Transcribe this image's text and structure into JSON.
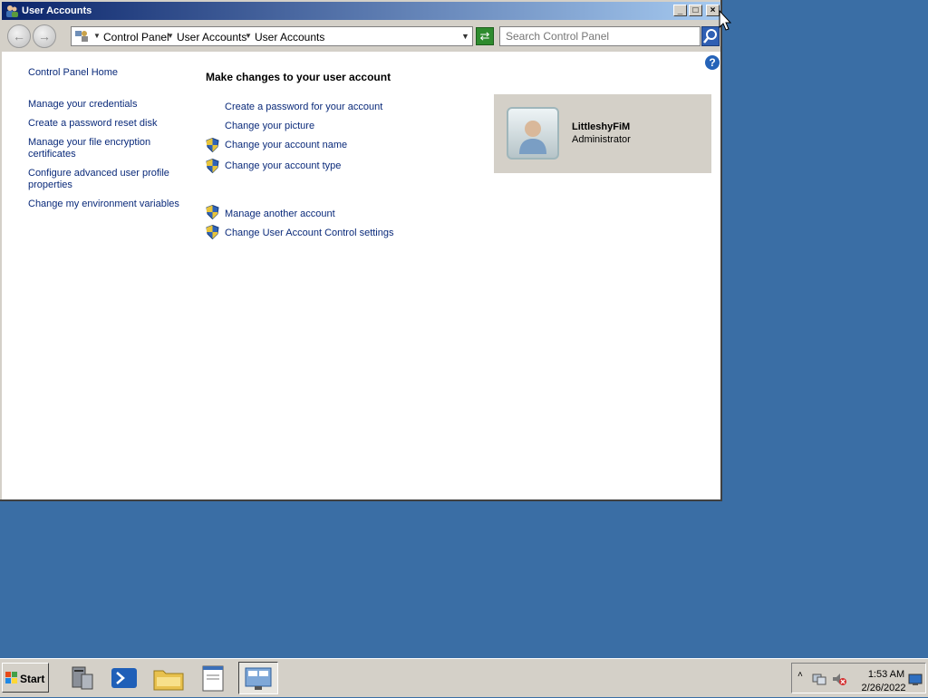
{
  "window": {
    "title": "User Accounts",
    "controls": {
      "minimize": "_",
      "maximize": "□",
      "close": "×"
    }
  },
  "addressbar": {
    "crumbs": [
      "Control Panel",
      "User Accounts",
      "User Accounts"
    ],
    "search_placeholder": "Search Control Panel"
  },
  "sidebar": {
    "home": "Control Panel Home",
    "items": [
      "Manage your credentials",
      "Create a password reset disk",
      "Manage your file encryption certificates",
      "Configure advanced user profile properties",
      "Change my environment variables"
    ]
  },
  "main": {
    "title": "Make changes to your user account",
    "tasks": [
      {
        "label": "Create a password for your account",
        "shield": false
      },
      {
        "label": "Change your picture",
        "shield": false
      },
      {
        "label": "Change your account name",
        "shield": true
      },
      {
        "label": "Change your account type",
        "shield": true
      }
    ],
    "other_tasks": [
      {
        "label": "Manage another account",
        "shield": true
      },
      {
        "label": "Change User Account Control settings",
        "shield": true
      }
    ]
  },
  "user": {
    "name": "LittleshyFiM",
    "role": "Administrator"
  },
  "taskbar": {
    "start_label": "Start",
    "time": "1:53 AM",
    "date": "2/26/2022",
    "items": [
      "server-manager-icon",
      "powershell-icon",
      "explorer-folder-icon",
      "notepad-icon",
      "control-panel-icon"
    ]
  },
  "colors": {
    "desktop": "#3a6ea5",
    "link": "#0a2a7a",
    "title_gradient_start": "#0a246a",
    "title_gradient_end": "#a6caf0"
  }
}
